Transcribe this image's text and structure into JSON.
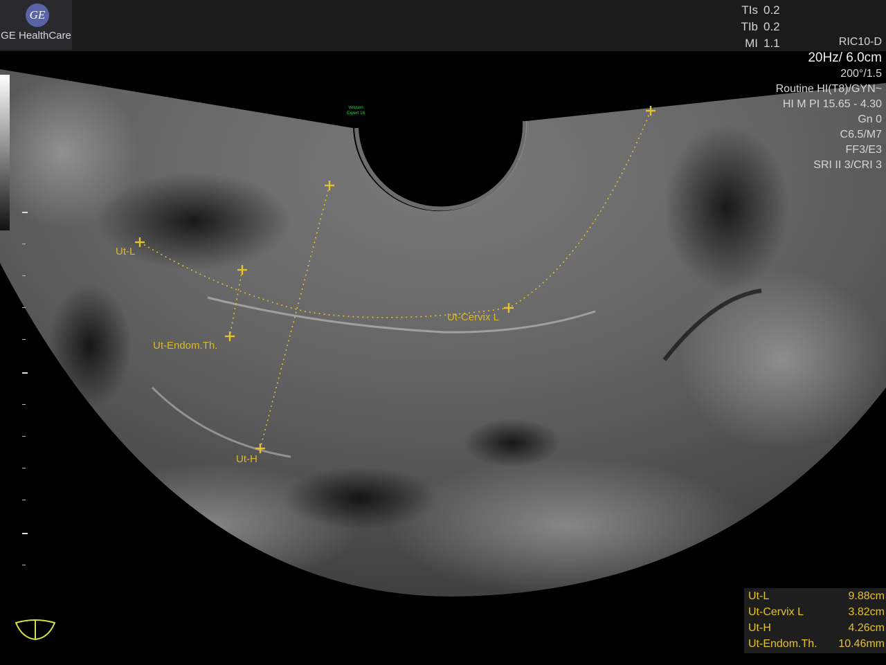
{
  "header": {
    "logo_monogram": "GE",
    "brand": "GE HealthCare",
    "indices": [
      {
        "key": "TIs",
        "value": "0.2"
      },
      {
        "key": "TIb",
        "value": "0.2"
      },
      {
        "key": "MI",
        "value": "1.1"
      }
    ],
    "probe": "RIC10-D"
  },
  "parameters": {
    "frame_depth": "20Hz/ 6.0cm",
    "lines": [
      "200°/1.5",
      "Routine HI(T8)/GYN~",
      "HI M PI 15.65 - 4.30",
      "Gn  0",
      "C6.5/M7",
      "FF3/E3",
      "SRI II 3/CRI 3"
    ]
  },
  "watermark": {
    "line1": "Voluson",
    "line2": "Expert 18"
  },
  "measurement_labels": {
    "ut_l": "Ut-L",
    "ut_cervix_l": "Ut-Cervix L",
    "ut_endom": "Ut-Endom.Th.",
    "ut_h": "Ut-H"
  },
  "results": [
    {
      "name": "Ut-L",
      "value": "9.88cm"
    },
    {
      "name": "Ut-Cervix L",
      "value": "3.82cm"
    },
    {
      "name": "Ut-H",
      "value": "4.26cm"
    },
    {
      "name": "Ut-Endom.Th.",
      "value": "10.46mm"
    }
  ],
  "colors": {
    "measurement": "#e6c22c",
    "watermark": "#33d24a",
    "logo": "#5a63a8"
  },
  "icons": {
    "probe_orientation": "probe-orientation-icon",
    "caliper": "caliper-cross-icon"
  }
}
